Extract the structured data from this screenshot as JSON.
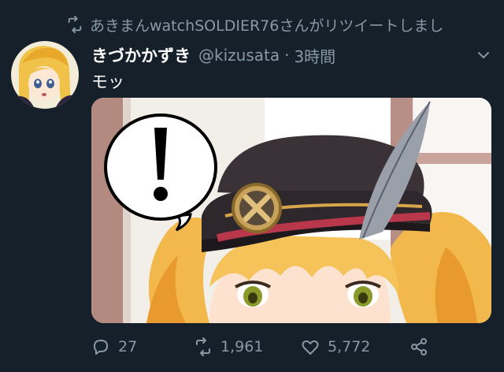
{
  "retweet_notice": {
    "text": "あきまんwatchSOLDIER76さんがリツイートしまし",
    "icon": "retweet-icon"
  },
  "tweet": {
    "display_name": "きづかかずき",
    "handle": "@kizusata",
    "separator": "·",
    "time": "3時間",
    "text": "モッ",
    "media_alt": "anime illustration: blonde twin-tail girl in black cap with feather, speech bubble with exclamation mark"
  },
  "actions": {
    "replies": "27",
    "retweets": "1,961",
    "likes": "5,772"
  },
  "icons": {
    "reply": "reply-icon",
    "retweet": "retweet-icon",
    "like": "heart-icon",
    "share": "share-icon",
    "menu": "chevron-down-icon"
  },
  "colors": {
    "background": "#15202b",
    "secondary_text": "#8899a6",
    "primary_text": "#ffffff"
  }
}
